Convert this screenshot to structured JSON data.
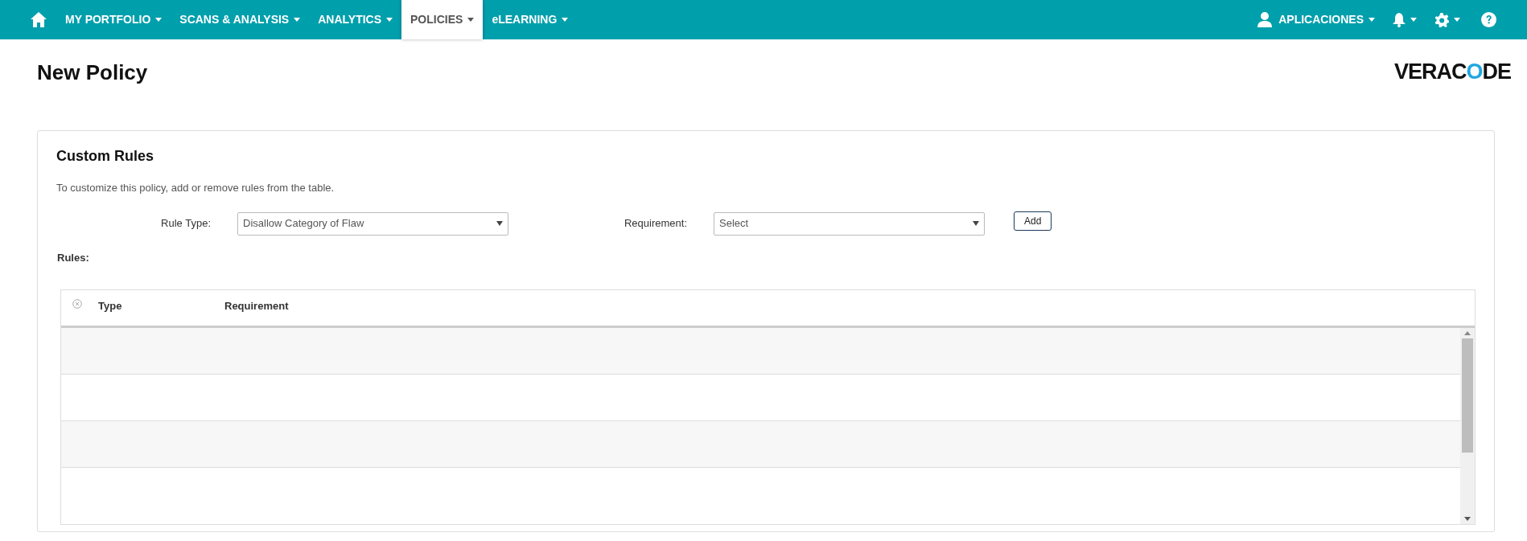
{
  "nav": {
    "items": [
      {
        "label": "MY PORTFOLIO",
        "selected": false
      },
      {
        "label": "SCANS & ANALYSIS",
        "selected": false
      },
      {
        "label": "ANALYTICS",
        "selected": false
      },
      {
        "label": "POLICIES",
        "selected": true
      },
      {
        "label": "eLEARNING",
        "selected": false
      }
    ],
    "user": "APLICACIONES"
  },
  "page": {
    "title": "New Policy",
    "logo": [
      {
        "text": "VERAC",
        "accent": false
      },
      {
        "text": "O",
        "accent": true
      },
      {
        "text": "DE",
        "accent": false
      }
    ]
  },
  "custom_rules": {
    "title": "Custom Rules",
    "description": "To customize this policy, add or remove rules from the table.",
    "rule_type": {
      "label": "Rule Type:",
      "value": "Disallow Category of Flaw"
    },
    "requirement": {
      "label": "Requirement:",
      "value": "Select"
    },
    "add_button": "Add",
    "rules_label": "Rules:",
    "table": {
      "columns": [
        "Type",
        "Requirement"
      ]
    }
  }
}
